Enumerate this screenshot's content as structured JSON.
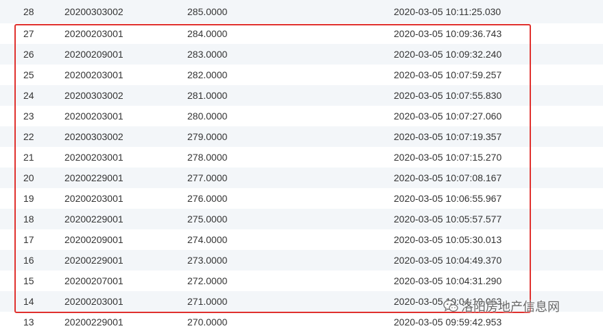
{
  "table": {
    "rows": [
      {
        "id": "28",
        "code": "20200303002",
        "price": "285.0000",
        "time": "2020-03-05 10:11:25.030"
      },
      {
        "id": "27",
        "code": "20200203001",
        "price": "284.0000",
        "time": "2020-03-05 10:09:36.743"
      },
      {
        "id": "26",
        "code": "20200209001",
        "price": "283.0000",
        "time": "2020-03-05 10:09:32.240"
      },
      {
        "id": "25",
        "code": "20200203001",
        "price": "282.0000",
        "time": "2020-03-05 10:07:59.257"
      },
      {
        "id": "24",
        "code": "20200303002",
        "price": "281.0000",
        "time": "2020-03-05 10:07:55.830"
      },
      {
        "id": "23",
        "code": "20200203001",
        "price": "280.0000",
        "time": "2020-03-05 10:07:27.060"
      },
      {
        "id": "22",
        "code": "20200303002",
        "price": "279.0000",
        "time": "2020-03-05 10:07:19.357"
      },
      {
        "id": "21",
        "code": "20200203001",
        "price": "278.0000",
        "time": "2020-03-05 10:07:15.270"
      },
      {
        "id": "20",
        "code": "20200229001",
        "price": "277.0000",
        "time": "2020-03-05 10:07:08.167"
      },
      {
        "id": "19",
        "code": "20200203001",
        "price": "276.0000",
        "time": "2020-03-05 10:06:55.967"
      },
      {
        "id": "18",
        "code": "20200229001",
        "price": "275.0000",
        "time": "2020-03-05 10:05:57.577"
      },
      {
        "id": "17",
        "code": "20200209001",
        "price": "274.0000",
        "time": "2020-03-05 10:05:30.013"
      },
      {
        "id": "16",
        "code": "20200229001",
        "price": "273.0000",
        "time": "2020-03-05 10:04:49.370"
      },
      {
        "id": "15",
        "code": "20200207001",
        "price": "272.0000",
        "time": "2020-03-05 10:04:31.290"
      },
      {
        "id": "14",
        "code": "20200203001",
        "price": "271.0000",
        "time": "2020-03-05 10:04:19.063"
      },
      {
        "id": "13",
        "code": "20200229001",
        "price": "270.0000",
        "time": "2020-03-05 09:59:42.953"
      }
    ]
  },
  "watermark": {
    "text": "洛阳房地产信息网",
    "icon": "wechat-icon"
  },
  "colors": {
    "highlight_border": "#e0302d",
    "row_alt": "#f3f6f9",
    "text": "#333333"
  }
}
